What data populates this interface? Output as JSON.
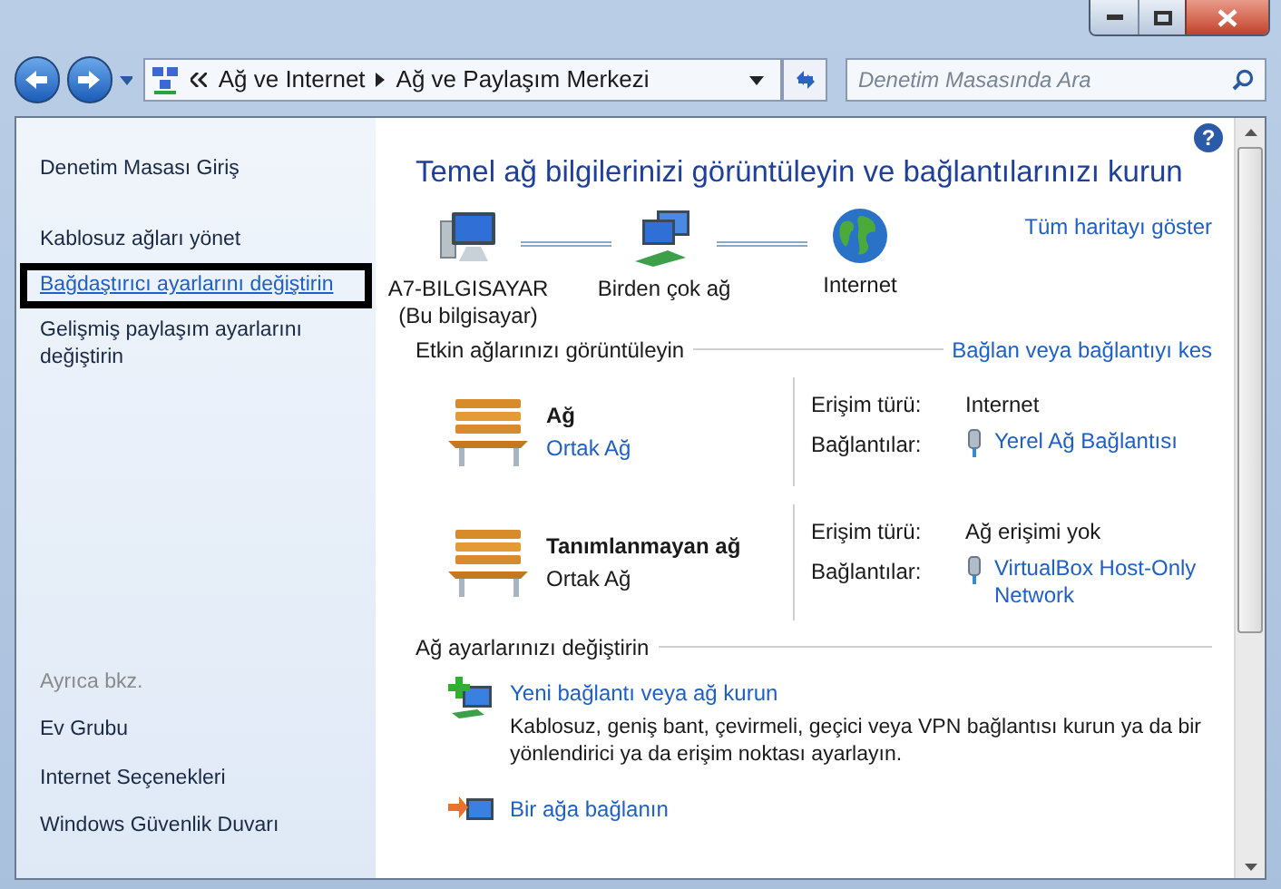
{
  "address_bar": {
    "crumbs": [
      "Ağ ve Internet",
      "Ağ ve Paylaşım Merkezi"
    ]
  },
  "search": {
    "placeholder": "Denetim Masasında Ara"
  },
  "sidebar": {
    "sections": [
      {
        "items": [
          {
            "label": "Denetim Masası Giriş",
            "link": false,
            "highlighted": false
          }
        ]
      },
      {
        "items": [
          {
            "label": "Kablosuz ağları yönet",
            "link": false,
            "highlighted": false
          },
          {
            "label": "Bağdaştırıcı ayarlarını değiştirin",
            "link": true,
            "highlighted": true
          },
          {
            "label": "Gelişmiş paylaşım ayarlarını değiştirin",
            "link": false,
            "highlighted": false
          }
        ]
      }
    ],
    "see_also": {
      "title": "Ayrıca bkz.",
      "items": [
        "Ev Grubu",
        "Internet Seçenekleri",
        "Windows Güvenlik Duvarı"
      ]
    }
  },
  "main": {
    "help": "?",
    "title": "Temel ağ bilgilerinizi görüntüleyin ve bağlantılarınızı kurun",
    "map": {
      "nodes": [
        {
          "kind": "computer",
          "label": "A7-BILGISAYAR",
          "sublabel": "(Bu bilgisayar)"
        },
        {
          "kind": "network",
          "label": "Birden çok ağ"
        },
        {
          "kind": "internet",
          "label": "Internet"
        }
      ],
      "show_map_link": "Tüm haritayı göster"
    },
    "active_networks": {
      "title": "Etkin ağlarınızı görüntüleyin",
      "action": "Bağlan veya bağlantıyı kes",
      "networks": [
        {
          "name": "Ağ",
          "category": "Ortak Ağ",
          "category_link": true,
          "access_label": "Erişim türü:",
          "access": "Internet",
          "connections_label": "Bağlantılar:",
          "connection": "Yerel Ağ Bağlantısı"
        },
        {
          "name": "Tanımlanmayan ağ",
          "category": "Ortak Ağ",
          "category_link": false,
          "access_label": "Erişim türü:",
          "access": "Ağ erişimi yok",
          "connections_label": "Bağlantılar:",
          "connection": "VirtualBox Host-Only Network"
        }
      ]
    },
    "settings": {
      "title": "Ağ ayarlarınızı değiştirin",
      "tasks": [
        {
          "kind": "new",
          "label": "Yeni bağlantı veya ağ kurun",
          "description": "Kablosuz, geniş bant, çevirmeli, geçici veya VPN bağlantısı kurun ya da bir yönlendirici ya da erişim noktası ayarlayın."
        },
        {
          "kind": "connect",
          "label": "Bir ağa bağlanın"
        }
      ]
    }
  }
}
